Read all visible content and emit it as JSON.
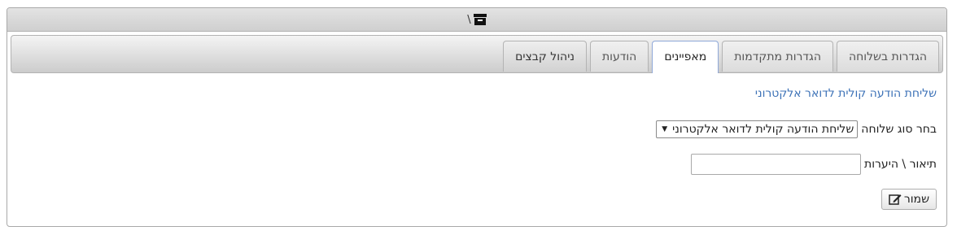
{
  "window": {
    "title": "\\"
  },
  "tabs": [
    {
      "label": "ניהול קבצים"
    },
    {
      "label": "הודעות"
    },
    {
      "label": "מאפיינים"
    },
    {
      "label": "הגדרות מתקדמות"
    },
    {
      "label": "הגדרות בשלוחה"
    }
  ],
  "active_tab": "מאפיינים",
  "form": {
    "heading": "שליחת הודעה קולית לדואר אלקטרוני",
    "type_label": "בחר סוג שלוחה",
    "type_selected": "שליחת הודעה קולית לדואר אלקטרוני",
    "description_label": "תיאור \\ היערות",
    "description_value": "",
    "save_label": "שמור"
  },
  "colors": {
    "heading": "#3d72b7",
    "active_tab_border": "#8fa8d8"
  },
  "icons": {
    "title": "archive-icon",
    "select": "triangle-down",
    "save": "edit-icon"
  }
}
